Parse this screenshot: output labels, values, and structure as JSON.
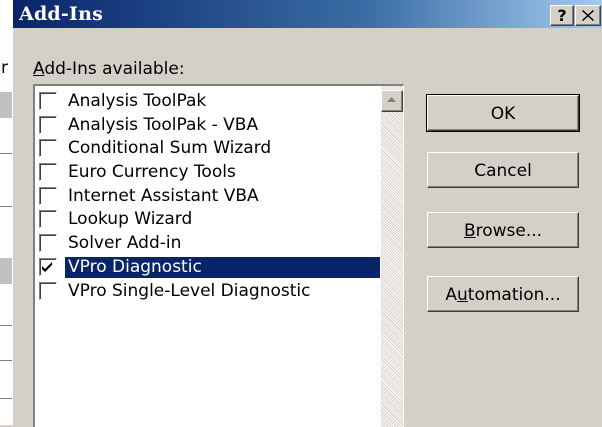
{
  "background_window": {
    "visible_char_top": "r"
  },
  "dialog": {
    "title": "Add-Ins",
    "help_button": "?",
    "close_button": "×",
    "list_label": "Add-Ins available:",
    "list_label_access_key": "A",
    "list_label_rest": "dd-Ins available:",
    "items": [
      {
        "label": "Analysis ToolPak",
        "checked": false,
        "selected": false
      },
      {
        "label": "Analysis ToolPak - VBA",
        "checked": false,
        "selected": false
      },
      {
        "label": "Conditional Sum Wizard",
        "checked": false,
        "selected": false
      },
      {
        "label": "Euro Currency Tools",
        "checked": false,
        "selected": false
      },
      {
        "label": "Internet Assistant VBA",
        "checked": false,
        "selected": false
      },
      {
        "label": "Lookup Wizard",
        "checked": false,
        "selected": false
      },
      {
        "label": "Solver Add-in",
        "checked": false,
        "selected": false
      },
      {
        "label": "VPro Diagnostic",
        "checked": true,
        "selected": true
      },
      {
        "label": "VPro Single-Level Diagnostic",
        "checked": false,
        "selected": false
      }
    ],
    "buttons": {
      "ok": "OK",
      "cancel": "Cancel",
      "browse_key": "B",
      "browse_rest": "rowse...",
      "automation_pre": "A",
      "automation_key": "u",
      "automation_rest": "tomation..."
    },
    "colors": {
      "titlebar_start": "#0a246a",
      "titlebar_end": "#a6caf0",
      "selection": "#0a246a",
      "face": "#d4d0c8"
    }
  }
}
